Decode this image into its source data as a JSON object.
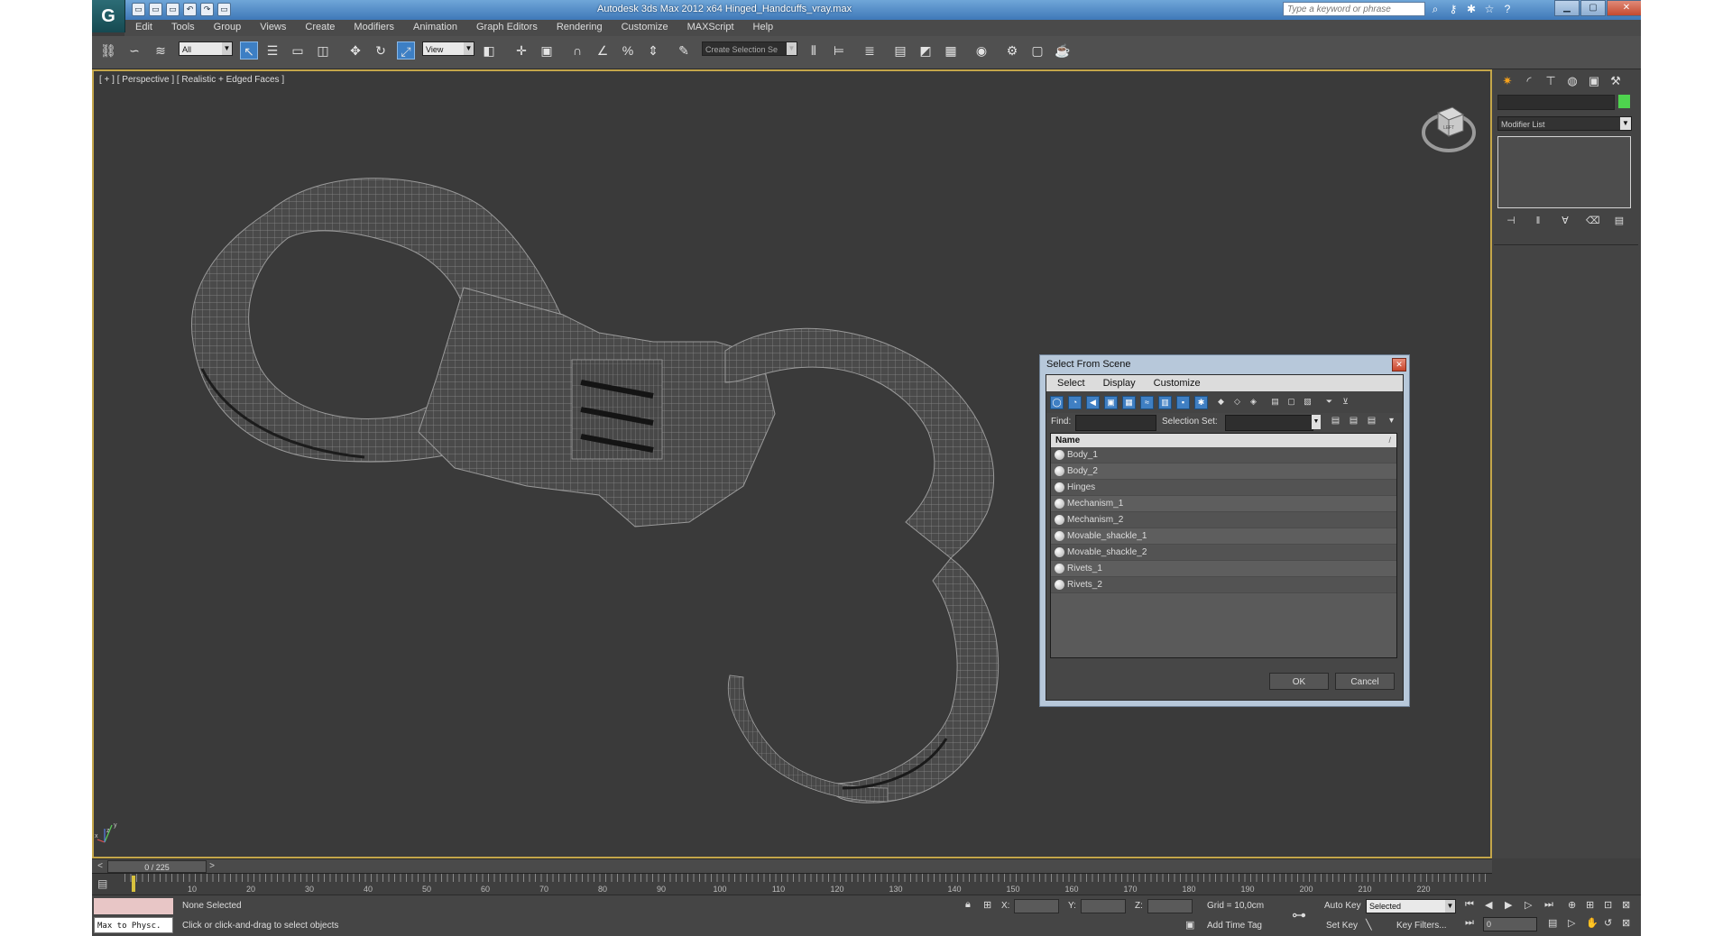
{
  "window": {
    "title": "Autodesk 3ds Max  2012 x64      Hinged_Handcuffs_vray.max",
    "search_placeholder": "Type a keyword or phrase",
    "logo_glyph": "G",
    "controls": [
      "▁",
      "▢",
      "✕"
    ]
  },
  "quick_access": [
    "▭",
    "▭",
    "▭",
    "↶",
    "↷",
    "▭"
  ],
  "menu": [
    "Edit",
    "Tools",
    "Group",
    "Views",
    "Create",
    "Modifiers",
    "Animation",
    "Graph Editors",
    "Rendering",
    "Customize",
    "MAXScript",
    "Help"
  ],
  "toolbar": {
    "selection_filter": "All",
    "ref_coord": "View",
    "named_selection": "Create Selection Se"
  },
  "viewport": {
    "label": "[ + ] [ Perspective ] [ Realistic + Edged Faces ]",
    "viewcube_label": "LEFT",
    "axis_labels": [
      "x",
      "y",
      "z"
    ]
  },
  "command_panel": {
    "modifier_list": "Modifier List",
    "color_swatch": "#4ed34e",
    "accent": "#f7a21b"
  },
  "dialog": {
    "title": "Select From Scene",
    "close_glyph": "✕",
    "menu": [
      "Select",
      "Display",
      "Customize"
    ],
    "find_label": "Find:",
    "selection_set_label": "Selection Set:",
    "column_header": "Name",
    "sort_indicator": "/",
    "objects": [
      "Body_1",
      "Body_2",
      "Hinges",
      "Mechanism_1",
      "Mechanism_2",
      "Movable_shackle_1",
      "Movable_shackle_2",
      "Rivets_1",
      "Rivets_2"
    ],
    "ok_label": "OK",
    "cancel_label": "Cancel"
  },
  "timeline": {
    "frame_display": "0 / 225",
    "prev_arrow": "<",
    "next_arrow": ">",
    "ticks": [
      "10",
      "20",
      "30",
      "40",
      "50",
      "60",
      "70",
      "80",
      "90",
      "100",
      "110",
      "120",
      "130",
      "140",
      "150",
      "160",
      "170",
      "180",
      "190",
      "200",
      "210",
      "220"
    ]
  },
  "status": {
    "script_listener": "Max to Physc.",
    "selection_status": "None Selected",
    "prompt": "Click or click-and-drag to select objects",
    "x_label": "X:",
    "y_label": "Y:",
    "z_label": "Z:",
    "grid": "Grid = 10,0cm",
    "add_time_tag": "Add Time Tag",
    "auto_key": "Auto Key",
    "set_key": "Set Key",
    "key_mode": "Selected",
    "key_filters": "Key Filters...",
    "current_frame": "0"
  }
}
